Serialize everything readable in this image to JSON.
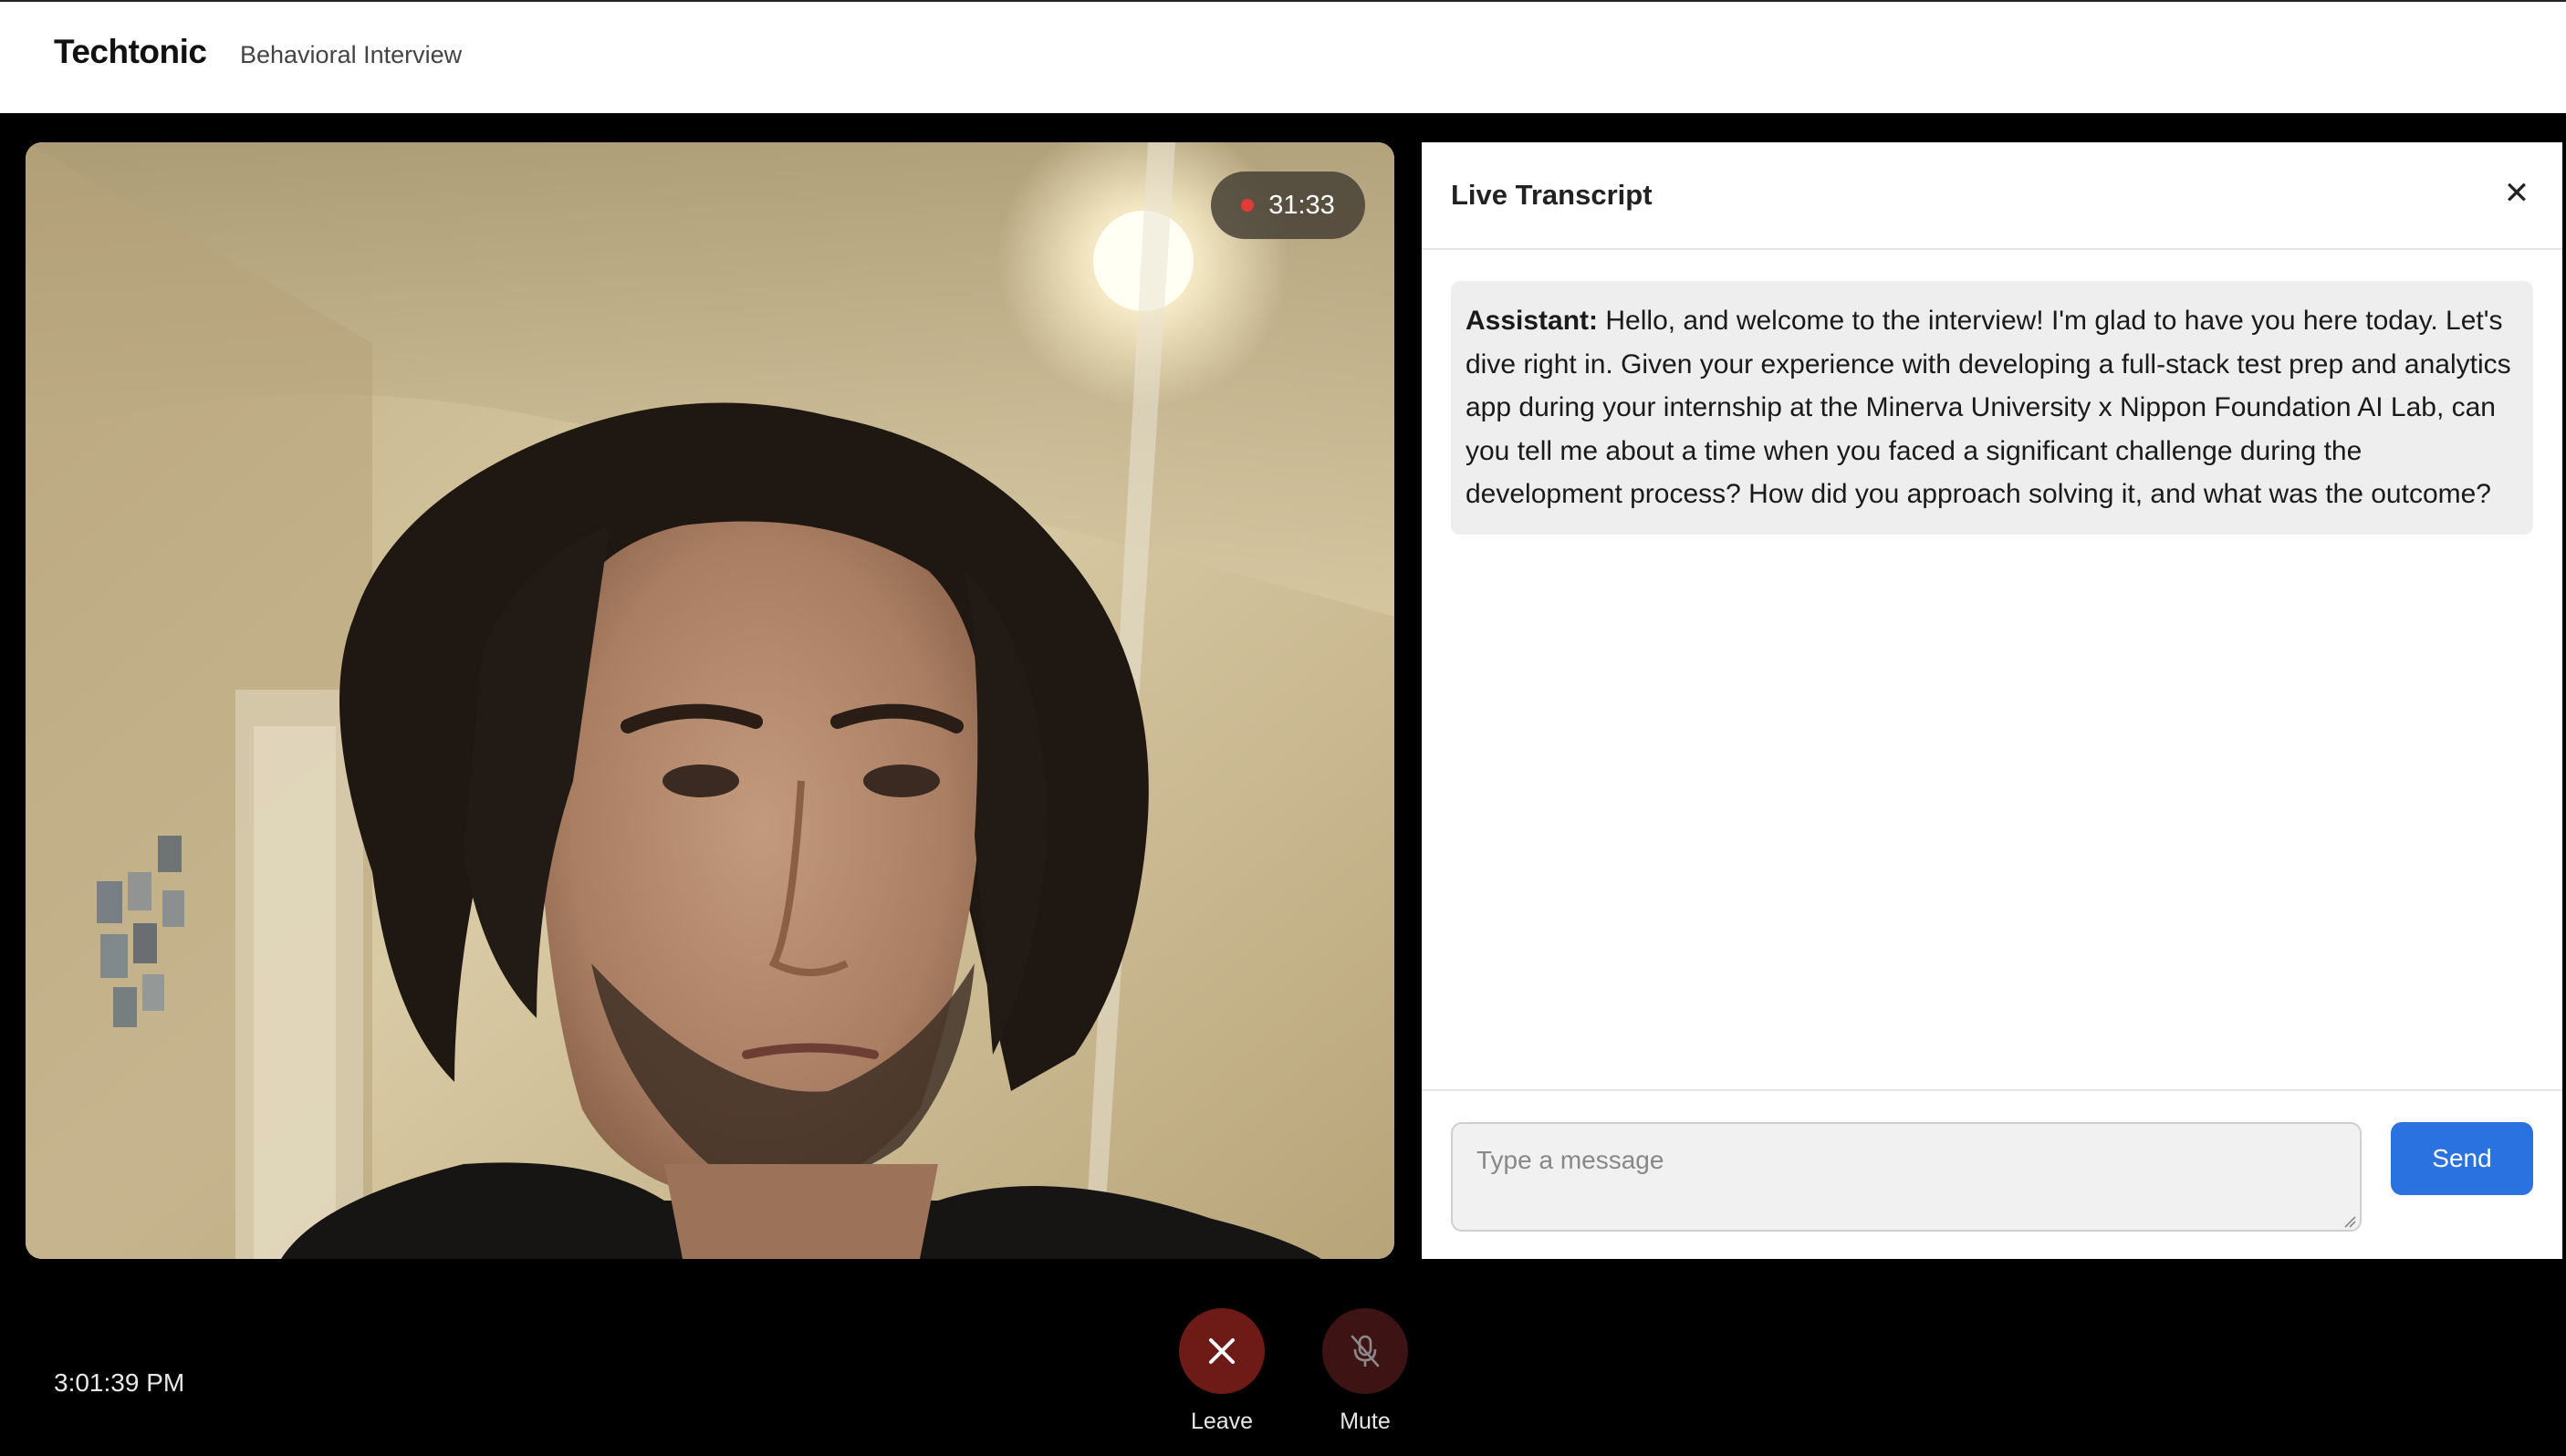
{
  "header": {
    "brand": "Techtonic",
    "subtitle": "Behavioral Interview"
  },
  "video": {
    "recording_indicator": "recording-dot-icon",
    "elapsed": "31:33"
  },
  "transcript": {
    "title": "Live Transcript",
    "close_icon": "close-icon",
    "messages": [
      {
        "speaker": "Assistant:",
        "text": "Hello, and welcome to the interview! I'm glad to have you here today. Let's dive right in. Given your experience with developing a full-stack test prep and analytics app during your internship at the Minerva University x Nippon Foundation AI Lab, can you tell me about a time when you faced a significant challenge during the development process? How did you approach solving it, and what was the outcome?"
      }
    ],
    "input": {
      "placeholder": "Type a message",
      "value": ""
    },
    "send_label": "Send"
  },
  "footer": {
    "clock": "3:01:39 PM",
    "controls": [
      {
        "icon": "close-icon",
        "label": "Leave"
      },
      {
        "icon": "mic-off-icon",
        "label": "Mute"
      }
    ]
  },
  "colors": {
    "accent": "#2a72e0",
    "leave_bg": "#6e1a17",
    "mute_bg": "#3d1413",
    "recording": "#e23a36"
  }
}
